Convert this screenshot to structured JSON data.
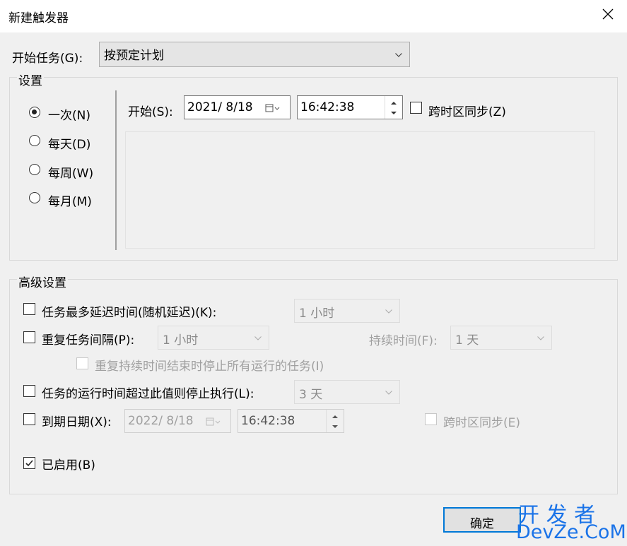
{
  "window": {
    "title": "新建触发器"
  },
  "begin_task": {
    "label": "开始任务(G):",
    "value": "按预定计划"
  },
  "settings": {
    "legend": "设置",
    "radios": [
      {
        "label": "一次(N)",
        "selected": true
      },
      {
        "label": "每天(D)",
        "selected": false
      },
      {
        "label": "每周(W)",
        "selected": false
      },
      {
        "label": "每月(M)",
        "selected": false
      }
    ],
    "start_label": "开始(S):",
    "start_date": "2021/  8/18",
    "start_time": "16:42:38",
    "sync_label": "跨时区同步(Z)"
  },
  "advanced": {
    "legend": "高级设置",
    "delay": {
      "label": "任务最多延迟时间(随机延迟)(K):",
      "value": "1 小时",
      "checked": false
    },
    "repeat": {
      "label": "重复任务间隔(P):",
      "value": "1 小时",
      "checked": false,
      "duration_label": "持续时间(F):",
      "duration_value": "1 天"
    },
    "stop_all": {
      "label": "重复持续时间结束时停止所有运行的任务(I)",
      "checked": false
    },
    "stop_if_longer": {
      "label": "任务的运行时间超过此值则停止执行(L):",
      "value": "3 天",
      "checked": false
    },
    "expire": {
      "label": "到期日期(X):",
      "date": "2022/  8/18",
      "time": "16:42:38",
      "sync_label": "跨时区同步(E)",
      "checked": false
    },
    "enabled": {
      "label": "已启用(B)",
      "checked": true
    }
  },
  "buttons": {
    "ok": "确定"
  },
  "watermark": {
    "line1": "开 发 者",
    "line2": "DevZe.CoM"
  }
}
